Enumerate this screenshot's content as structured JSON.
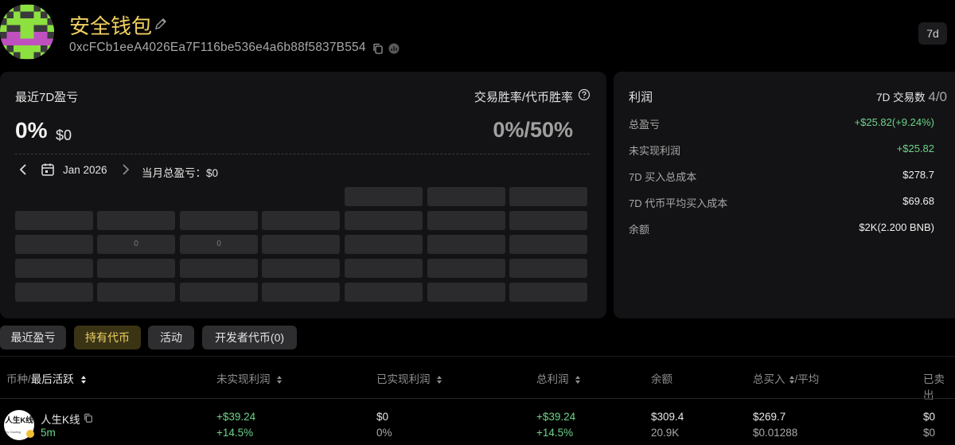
{
  "header": {
    "wallet_name": "安全钱包",
    "address": "0xcFCb1eeA4026Ea7F116be536e4a6b88f5837B554",
    "range": "7d"
  },
  "pnl_card": {
    "title": "最近7D盈亏",
    "pct": "0%",
    "usd": "$0",
    "winrate_title": "交易胜率/代币胜率",
    "winrate_value": "0%/50%",
    "month": "Jan 2026",
    "month_total": "当月总盈亏：$0",
    "calendar_cells": [
      "0",
      "0"
    ]
  },
  "profit_card": {
    "title": "利润",
    "trades_label": "7D 交易数",
    "trades_count": "4/0",
    "rows": [
      {
        "label": "总盈亏",
        "value": "+$25.82(+9.24%)"
      },
      {
        "label": "未实现利润",
        "value": "+$25.82"
      },
      {
        "label": "7D 买入总成本",
        "value": "$278.7"
      },
      {
        "label": "7D 代币平均买入成本",
        "value": "$69.68"
      },
      {
        "label": "余额",
        "value": "$2K(2.200 BNB)"
      }
    ]
  },
  "tabs": [
    "最近盈亏",
    "持有代币",
    "活动",
    "开发者代币(0)"
  ],
  "table": {
    "headers": {
      "token_prefix": "币种/",
      "token_sort": "最后活跃",
      "unrealized": "未实现利润",
      "realized": "已实现利润",
      "total": "总利润",
      "balance": "余额",
      "bought_prefix": "总买入",
      "bought_suffix": "/平均",
      "sold": "已卖出"
    },
    "rows": [
      {
        "icon_text": "人生K线",
        "icon_caption": "by Gaoling",
        "name": "人生K线",
        "age": "5m",
        "unrealized": "+$39.24",
        "unrealized_pct": "+14.5%",
        "realized": "$0",
        "realized_pct": "0%",
        "total": "+$39.24",
        "total_pct": "+14.5%",
        "balance": "$309.4",
        "balance_amount": "20.9K",
        "bought": "$269.7",
        "bought_avg": "$0.01288",
        "sold": "$0",
        "sold_avg": "$0"
      }
    ]
  },
  "colors": {
    "accent": "#f0d060",
    "positive": "#6ed38a",
    "card_bg": "#131315"
  }
}
